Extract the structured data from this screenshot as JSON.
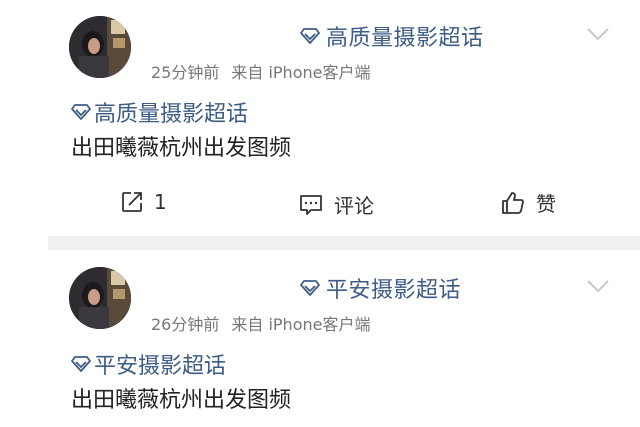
{
  "posts": [
    {
      "topic": "高质量摄影超话",
      "time": "25分钟前",
      "source": "来自 iPhone客户端",
      "tag": "高质量摄影超话",
      "content": "出田曦薇杭州出发图频",
      "actions": {
        "repost_count": "1",
        "comment_label": "评论",
        "like_label": "赞"
      }
    },
    {
      "topic": "平安摄影超话",
      "time": "26分钟前",
      "source": "来自 iPhone客户端",
      "tag": "平安摄影超话",
      "content": "出田曦薇杭州出发图频"
    }
  ],
  "colors": {
    "topic_blue": "#3e5d86",
    "separator": "#f0f0f0"
  },
  "icons": [
    "diamond-icon",
    "chevron-down-icon",
    "repost-icon",
    "comment-icon",
    "like-icon"
  ]
}
